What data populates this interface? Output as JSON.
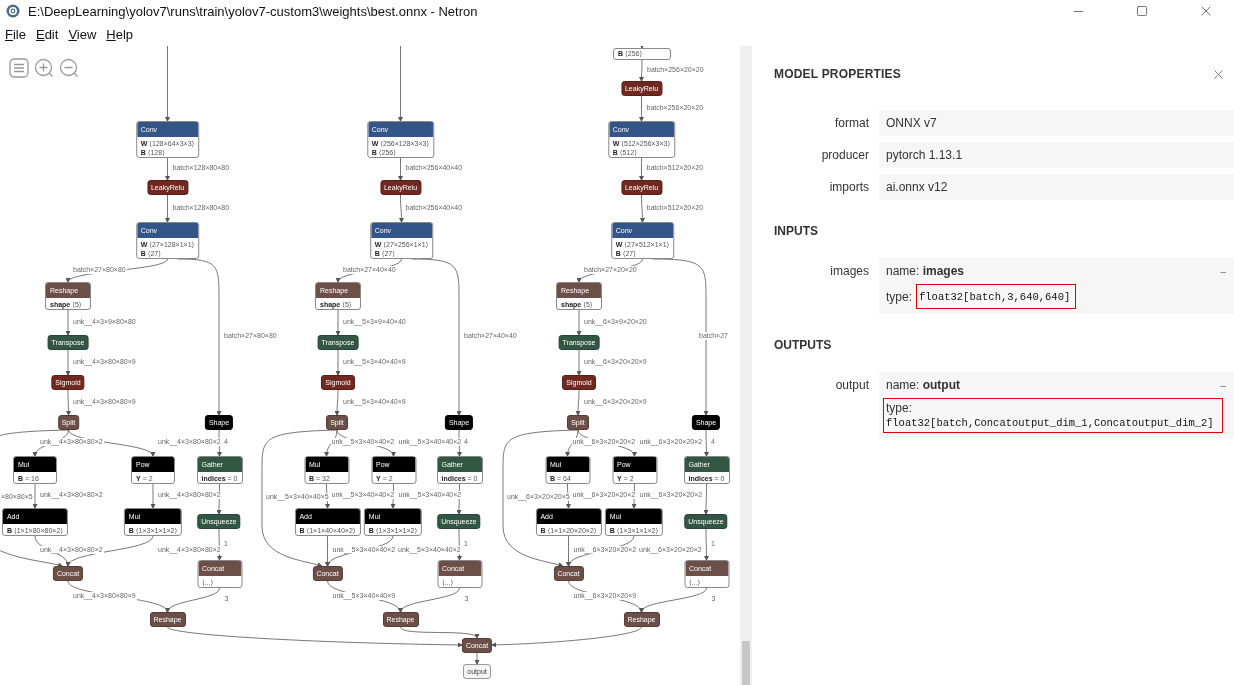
{
  "window": {
    "title": "E:\\DeepLearning\\yolov7\\runs\\train\\yolov7-custom3\\weights\\best.onnx - Netron"
  },
  "menu": [
    "File",
    "Edit",
    "View",
    "Help"
  ],
  "graph": {
    "columns": [
      {
        "nodes": [
          {
            "op": "Conv",
            "kind": "layer",
            "attributes": [
              {
                "name": "W",
                "value": "⟨128×64×3×3⟩"
              },
              {
                "name": "B",
                "value": "⟨128⟩"
              }
            ]
          },
          {
            "op": "LeakyRelu",
            "kind": "activation"
          },
          {
            "op": "Conv",
            "kind": "layer",
            "attributes": [
              {
                "name": "W",
                "value": "⟨27×128×1×1⟩"
              },
              {
                "name": "B",
                "value": "⟨27⟩"
              }
            ]
          },
          {
            "op": "Reshape",
            "kind": "tensor",
            "attributes": [
              {
                "name": "shape",
                "value": "⟨5⟩"
              }
            ]
          },
          {
            "op": "Transpose",
            "kind": "transform"
          },
          {
            "op": "Sigmoid",
            "kind": "activation"
          },
          {
            "op": "Split",
            "kind": "tensor"
          },
          {
            "op": "Mul",
            "kind": "default",
            "attributes": [
              {
                "name": "B",
                "value": "= 16"
              }
            ]
          },
          {
            "op": "Pow",
            "kind": "default",
            "attributes": [
              {
                "name": "Y",
                "value": "= 2"
              }
            ]
          },
          {
            "op": "Add",
            "kind": "default",
            "attributes": [
              {
                "name": "B",
                "value": "⟨1×1×80×80×2⟩"
              }
            ]
          },
          {
            "op": "Mul",
            "kind": "default",
            "attributes": [
              {
                "name": "B",
                "value": "⟨1×3×1×1×2⟩"
              }
            ]
          },
          {
            "op": "Concat",
            "kind": "tensor"
          },
          {
            "op": "Shape",
            "kind": "default"
          },
          {
            "op": "Gather",
            "kind": "transform",
            "attributes": [
              {
                "name": "indices",
                "value": "= 0"
              }
            ]
          },
          {
            "op": "Unsqueeze",
            "kind": "transform"
          },
          {
            "op": "Concat",
            "kind": "tensor",
            "attributes": [
              {
                "value": "⟨...⟩"
              }
            ]
          },
          {
            "op": "Reshape",
            "kind": "tensor"
          }
        ],
        "edge_labels": [
          "batch×128×80×80",
          "batch×128×80×80",
          "batch×27×80×80",
          "unk__4×3×9×80×80",
          "unk__4×3×80×80×9",
          "unk__4×3×80×80×9",
          "unk__4×3×80×80×2",
          "unk__4×3×80×80×2",
          "×80×80×5",
          "unk__4×3×80×80×2",
          "unk__4×3×80×80×2",
          "unk__4×3×80×80×2",
          "unk__4×3×80×80×2",
          "batch×27×80×80",
          "4",
          "1",
          "unk__4×3×80×80×9",
          "3"
        ]
      },
      {
        "nodes": [
          {
            "op": "Conv",
            "kind": "layer",
            "attributes": [
              {
                "name": "W",
                "value": "⟨256×128×3×3⟩"
              },
              {
                "name": "B",
                "value": "⟨256⟩"
              }
            ]
          },
          {
            "op": "LeakyRelu",
            "kind": "activation"
          },
          {
            "op": "Conv",
            "kind": "layer",
            "attributes": [
              {
                "name": "W",
                "value": "⟨27×256×1×1⟩"
              },
              {
                "name": "B",
                "value": "⟨27⟩"
              }
            ]
          },
          {
            "op": "Reshape",
            "kind": "tensor",
            "attributes": [
              {
                "name": "shape",
                "value": "⟨5⟩"
              }
            ]
          },
          {
            "op": "Transpose",
            "kind": "transform"
          },
          {
            "op": "Sigmoid",
            "kind": "activation"
          },
          {
            "op": "Split",
            "kind": "tensor"
          },
          {
            "op": "Mul",
            "kind": "default",
            "attributes": [
              {
                "name": "B",
                "value": "= 32"
              }
            ]
          },
          {
            "op": "Pow",
            "kind": "default",
            "attributes": [
              {
                "name": "Y",
                "value": "= 2"
              }
            ]
          },
          {
            "op": "Add",
            "kind": "default",
            "attributes": [
              {
                "name": "B",
                "value": "⟨1×1×40×40×2⟩"
              }
            ]
          },
          {
            "op": "Mul",
            "kind": "default",
            "attributes": [
              {
                "name": "B",
                "value": "⟨1×3×1×1×2⟩"
              }
            ]
          },
          {
            "op": "Concat",
            "kind": "tensor"
          },
          {
            "op": "Shape",
            "kind": "default"
          },
          {
            "op": "Gather",
            "kind": "transform",
            "attributes": [
              {
                "name": "indices",
                "value": "= 0"
              }
            ]
          },
          {
            "op": "Unsqueeze",
            "kind": "transform"
          },
          {
            "op": "Concat",
            "kind": "tensor",
            "attributes": [
              {
                "value": "⟨...⟩"
              }
            ]
          },
          {
            "op": "Reshape",
            "kind": "tensor"
          }
        ],
        "edge_labels": [
          "batch×256×40×40",
          "batch×256×40×40",
          "batch×27×40×40",
          "unk__5×3×9×40×40",
          "unk__5×3×40×40×9",
          "unk__5×3×40×40×9",
          "unk__5×3×40×40×2",
          "unk__5×3×40×40×2",
          "unk__5×3×40×40×5",
          "unk__5×3×40×40×2",
          "unk__5×3×40×40×2",
          "unk__5×3×40×40×2",
          "unk__5×3×40×40×2",
          "batch×27×40×40",
          "4",
          "1",
          "unk__5×3×40×40×9",
          "3"
        ]
      },
      {
        "nodes": [
          {
            "kind": "partial",
            "attributes": [
              {
                "name": "B",
                "value": "⟨256⟩"
              }
            ]
          },
          {
            "op": "LeakyRelu",
            "kind": "activation"
          },
          {
            "op": "Conv",
            "kind": "layer",
            "attributes": [
              {
                "name": "W",
                "value": "⟨512×256×3×3⟩"
              },
              {
                "name": "B",
                "value": "⟨512⟩"
              }
            ]
          },
          {
            "op": "LeakyRelu",
            "kind": "activation"
          },
          {
            "op": "Conv",
            "kind": "layer",
            "attributes": [
              {
                "name": "W",
                "value": "⟨27×512×1×1⟩"
              },
              {
                "name": "B",
                "value": "⟨27⟩"
              }
            ]
          },
          {
            "op": "Reshape",
            "kind": "tensor",
            "attributes": [
              {
                "name": "shape",
                "value": "⟨5⟩"
              }
            ]
          },
          {
            "op": "Transpose",
            "kind": "transform"
          },
          {
            "op": "Sigmoid",
            "kind": "activation"
          },
          {
            "op": "Split",
            "kind": "tensor"
          },
          {
            "op": "Mul",
            "kind": "default",
            "attributes": [
              {
                "name": "B",
                "value": "= 64"
              }
            ]
          },
          {
            "op": "Pow",
            "kind": "default",
            "attributes": [
              {
                "name": "Y",
                "value": "= 2"
              }
            ]
          },
          {
            "op": "Add",
            "kind": "default",
            "attributes": [
              {
                "name": "B",
                "value": "⟨1×1×20×20×2⟩"
              }
            ]
          },
          {
            "op": "Mul",
            "kind": "default",
            "attributes": [
              {
                "name": "B",
                "value": "⟨1×3×1×1×2⟩"
              }
            ]
          },
          {
            "op": "Concat",
            "kind": "tensor"
          },
          {
            "op": "Shape",
            "kind": "default"
          },
          {
            "op": "Gather",
            "kind": "transform",
            "attributes": [
              {
                "name": "indices",
                "value": "= 0"
              }
            ]
          },
          {
            "op": "Unsqueeze",
            "kind": "transform"
          },
          {
            "op": "Concat",
            "kind": "tensor",
            "attributes": [
              {
                "value": "⟨...⟩"
              }
            ]
          },
          {
            "op": "Reshape",
            "kind": "tensor"
          }
        ],
        "edge_labels": [
          "batch×256×20×20",
          "batch×256×20×20",
          "batch×512×20×20",
          "batch×512×20×20",
          "batch×27×20×20",
          "unk__6×3×9×20×20",
          "unk__6×3×20×20×9",
          "unk__6×3×20×20×9",
          "unk__6×3×20×20×2",
          "unk__6×3×20×20×2",
          "unk__6×3×20×20×5",
          "unk__6×3×20×20×2",
          "unk__6×3×20×20×2",
          "unk__6×3×20×20×2",
          "unk__6×3×20×20×2",
          "batch×27",
          "4",
          "1",
          "unk__6×3×20×20×9",
          "3"
        ]
      }
    ],
    "merge": [
      {
        "op": "Concat",
        "kind": "tensor"
      },
      {
        "op": "output",
        "kind": "output"
      }
    ]
  },
  "properties": {
    "title": "MODEL PROPERTIES",
    "model": [
      {
        "label": "format",
        "value": "ONNX v7"
      },
      {
        "label": "producer",
        "value": "pytorch 1.13.1"
      },
      {
        "label": "imports",
        "value": "ai.onnx v12"
      }
    ],
    "sections": [
      {
        "title": "INPUTS",
        "items": [
          {
            "label": "images",
            "name": "name: **images**",
            "toggle": "–",
            "type_label": "type:",
            "type": "float32[batch,3,640,640]",
            "kind": "inline"
          }
        ]
      },
      {
        "title": "OUTPUTS",
        "items": [
          {
            "label": "output",
            "name": "name: **output**",
            "toggle": "–",
            "type_label": "type:",
            "type": "float32[batch,Concatoutput_dim_1,Concatoutput_dim_2]",
            "kind": "stacked"
          }
        ]
      }
    ]
  }
}
